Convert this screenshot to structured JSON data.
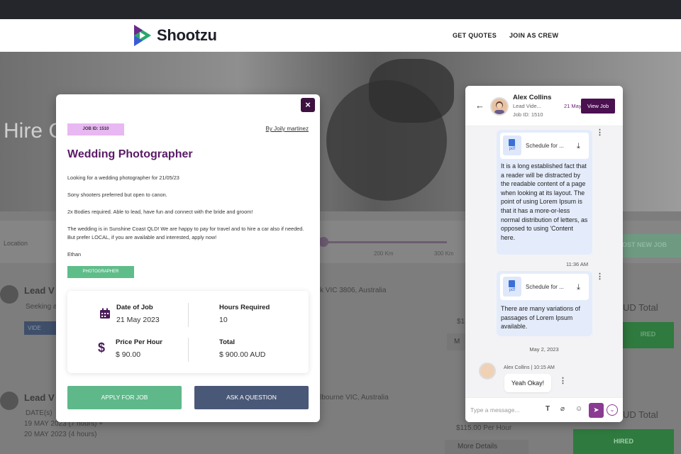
{
  "brand": {
    "name": "Shootzu"
  },
  "nav": {
    "get_quotes": "GET QUOTES",
    "join_crew": "JOIN AS CREW"
  },
  "background": {
    "hero_title": "Hire C",
    "location_label": "Location",
    "ticks": [
      "200 Km",
      "300 Km"
    ],
    "post_job": "OST NEW JOB",
    "rows": [
      {
        "title": "Lead V",
        "text": "Seeking a",
        "location": "k VIC 3806, Australia",
        "price": "$1",
        "more": "M",
        "total": "UD Total",
        "status": "IRED",
        "small_btn": "VIDE"
      },
      {
        "title": "Lead V",
        "dates_label": "DATE(s)",
        "date1": "19 MAY 2023 (7 hours) +",
        "date2": "20 MAY 2023 (4 hours)",
        "location": "lbourne VIC, Australia",
        "price": "$115.00 Per Hour",
        "more": "More Details",
        "total": "UD Total",
        "status": "HIRED"
      }
    ]
  },
  "modal": {
    "job_id": "JOB ID: 1510",
    "by": "By Joily martinez",
    "title": "Wedding Photographer",
    "paragraphs": [
      "Looking for a wedding photographer for 21/05/23",
      "Sony shooters preferred but open to canon.",
      "2x Bodies required. Able to lead, have fun and connect with the bride and groom!",
      "The wedding is in Sunshine Coast QLD! We are happy to pay for travel and to hire a car also if needed. But prefer LOCAL, if you are available and interested, apply now!",
      "Ethan"
    ],
    "tag": "PHOTOGRAPHER",
    "date_label": "Date of Job",
    "date_value": "21 May 2023",
    "hours_label": "Hours Required",
    "hours_value": "10",
    "price_label": "Price Per Hour",
    "price_value": "$ 90.00",
    "total_label": "Total",
    "total_value": "$ 900.00 AUD",
    "apply": "APPLY FOR JOB",
    "ask": "ASK A QUESTION",
    "close": "×"
  },
  "chat": {
    "name": "Alex Collins",
    "role": "Lead Vide...",
    "date": "21 May 2...",
    "job_id": "Job ID: 1510",
    "view_job": "View Job",
    "messages": [
      {
        "file": "Schedule for ...",
        "file_type": "pdf",
        "text": "It is a long established fact that a reader will be distracted by the readable content of a page when looking at its layout. The point of using Lorem Ipsum is that it has a more-or-less normal distribution of letters, as opposed to using 'Content here.",
        "time": "11:36 AM"
      },
      {
        "file": "Schedule for ...",
        "file_type": "pdf",
        "text": "There are many variations of passages of Lorem Ipsum available."
      }
    ],
    "day_sep": "May 2, 2023",
    "reply_meta": "Alex Collins | 10:15 AM",
    "reply_text": "Yeah Okay!",
    "input_placeholder": "Type a message..."
  },
  "colors": {
    "brand_purple": "#5a1a66",
    "apply_green": "#5fb88a",
    "ask_blue": "#4a5878"
  }
}
